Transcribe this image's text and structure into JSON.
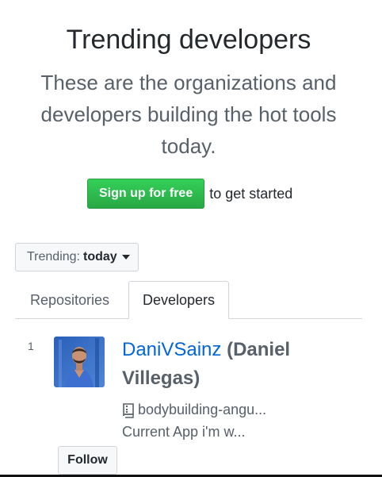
{
  "hero": {
    "title": "Trending developers",
    "subtitle": "These are the organizations and developers building the hot tools today."
  },
  "signup": {
    "button_label": "Sign up for free",
    "suffix": "to get started"
  },
  "trending_filter": {
    "label": "Trending:",
    "value": "today",
    "icon": "caret-down-icon"
  },
  "tabs": [
    {
      "label": "Repositories",
      "selected": false
    },
    {
      "label": "Developers",
      "selected": true
    }
  ],
  "developers": [
    {
      "rank": "1",
      "login": "DaniVSainz",
      "full_name": "(Daniel Villegas)",
      "repo_icon": "repo-icon",
      "repo": "bodybuilding-angu...",
      "description": "Current App i'm w...",
      "follow_label": "Follow"
    }
  ],
  "colors": {
    "link": "#0366d6",
    "primary_button": "#28a745",
    "muted_text": "#586069"
  }
}
